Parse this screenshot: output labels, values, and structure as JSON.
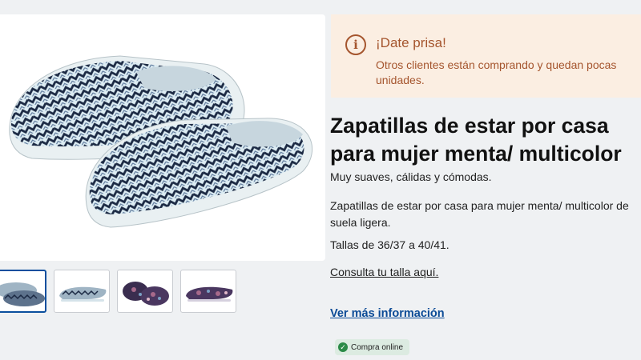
{
  "gallery": {
    "thumbnails": [
      {
        "label": "Zapatillas menta/ multicolor - vista par",
        "icon": "slipper-pair-chevron-image",
        "colors": {
          "dark": "#1c2a44",
          "light": "#d7e8f1"
        }
      },
      {
        "label": "Zapatillas menta/ multicolor - vista lateral",
        "icon": "slipper-side-chevron-image",
        "colors": {
          "dark": "#1c2a44",
          "light": "#d7e8f1"
        }
      },
      {
        "label": "Zapatillas multicolor - vista par",
        "icon": "slipper-pair-floral-image",
        "colors": {
          "dark": "#3a2d4f",
          "light": "#a76a8b"
        }
      },
      {
        "label": "Zapatillas multicolor - vista lateral",
        "icon": "slipper-side-floral-image",
        "colors": {
          "dark": "#3a2d4f",
          "light": "#a76a8b"
        }
      }
    ]
  },
  "alert": {
    "icon": "info-icon",
    "title": "¡Date prisa!",
    "message": "Otros clientes están comprando y quedan pocas unidades."
  },
  "product": {
    "title": "Zapatillas de estar por casa para mujer menta/ multicolor",
    "tagline": "Muy suaves, cálidas y cómodas.",
    "description": "Zapatillas de estar por casa para mujer menta/ multicolor de suela ligera.",
    "sizes": "Tallas de 36/37 a 40/41.",
    "size_link": "Consulta tu talla aquí.",
    "more_info_link": "Ver más información",
    "badge": "Compra online"
  },
  "colors": {
    "alert_background": "#fbeee2",
    "alert_text": "#a5552e",
    "link_blue": "#0a4a96",
    "badge_green": "#2b8a47"
  }
}
